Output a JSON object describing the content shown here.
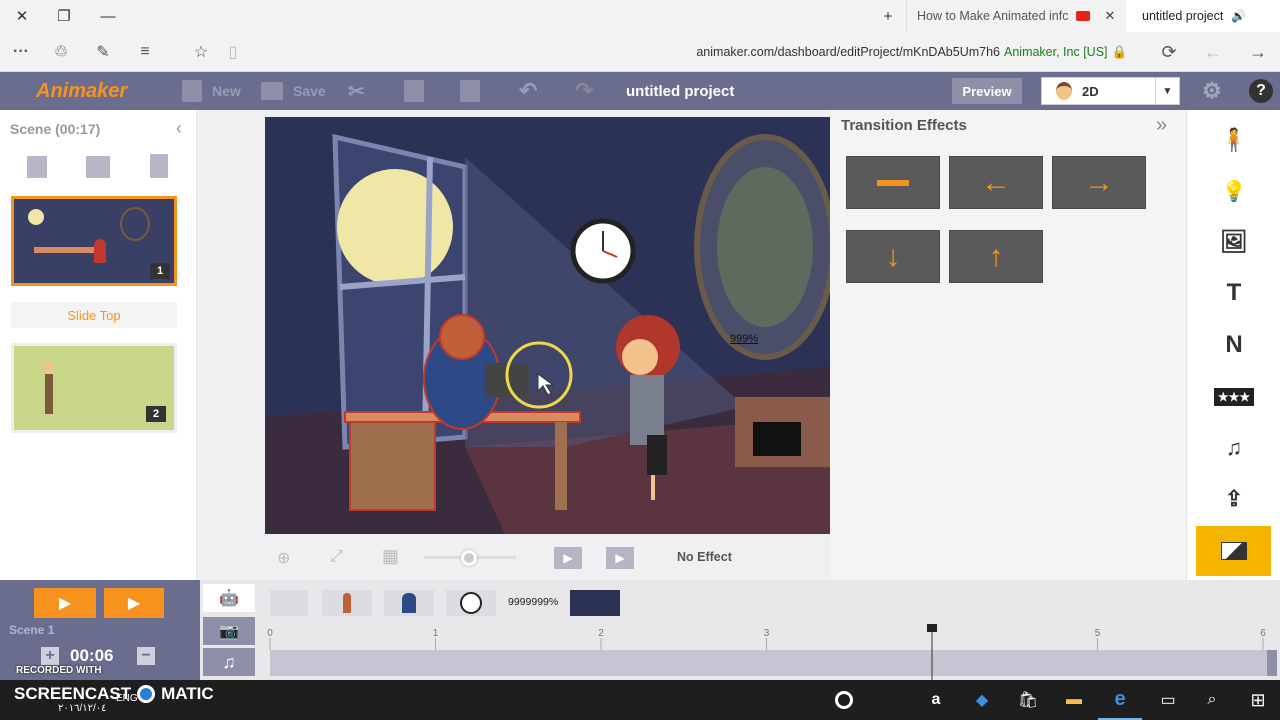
{
  "browser": {
    "tabs": [
      {
        "title": "How to Make Animated infc"
      },
      {
        "title": "untitled project"
      }
    ],
    "url": "animaker.com/dashboard/editProject/mKnDAb5Um7h6",
    "site_identity": "Animaker, Inc [US]"
  },
  "app": {
    "logo": "Animaker",
    "toolbar": {
      "new_label": "New",
      "save_label": "Save"
    },
    "project_title": "untitled project",
    "preview_label": "Preview",
    "mode_label": "2D"
  },
  "scene_panel": {
    "title": "Scene (00:17)",
    "slides": [
      {
        "number": "1"
      },
      {
        "number": "2"
      }
    ],
    "slide_top_label": "Slide Top"
  },
  "stage": {
    "frame_label": "999%",
    "no_effect_label": "No Effect"
  },
  "transitions": {
    "title": "Transition Effects",
    "effects": [
      {
        "name": "none-icon"
      },
      {
        "name": "arrow-left-icon"
      },
      {
        "name": "arrow-right-icon"
      },
      {
        "name": "arrow-down-icon"
      },
      {
        "name": "arrow-up-icon"
      }
    ]
  },
  "right_toolbar": {
    "items": [
      "character-icon",
      "bulb-icon",
      "image-icon",
      "text-icon",
      "N",
      "stars-icon",
      "music-icon",
      "upload-icon",
      "background-icon"
    ],
    "text_label": "T",
    "n_label": "N"
  },
  "timeline": {
    "scene_label": "Scene 1",
    "time": "00:06",
    "ticks": [
      "0",
      "1",
      "2",
      "3",
      "5",
      "6"
    ],
    "item_percent": "9999999%",
    "playhead_time": 4.0
  },
  "watermark": {
    "line1": "RECORDED WITH",
    "line2": "SCREENCAST",
    "line3": "MATIC",
    "date": "٢٠١٦/١٢/٠٤"
  },
  "taskbar": {
    "lang": "ENG"
  },
  "colors": {
    "accent": "#f7921e",
    "toolbar": "#6b6d8f",
    "selected_tool": "#f5b400"
  }
}
